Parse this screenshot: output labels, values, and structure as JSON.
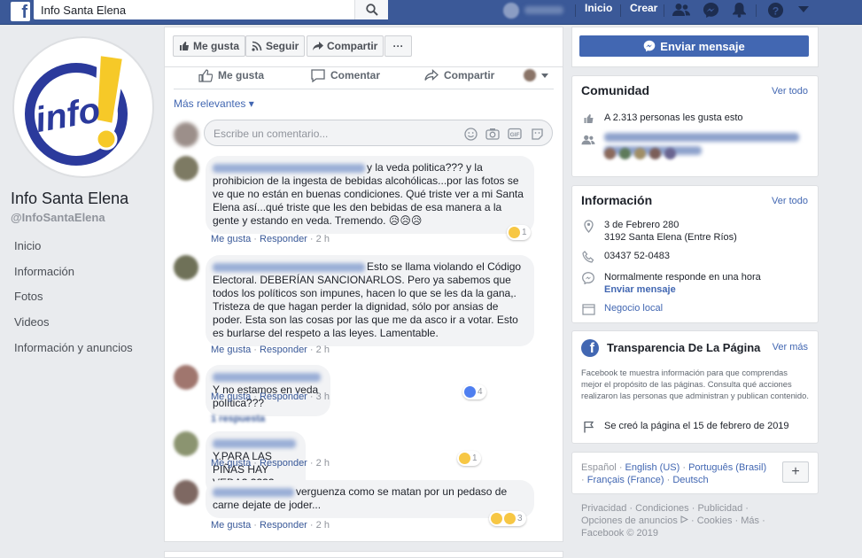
{
  "topbar": {
    "search_value": "Info Santa Elena",
    "home": "Inicio",
    "create": "Crear",
    "icons": [
      "friends-icon",
      "messenger-icon",
      "notifications-icon",
      "help-icon",
      "account-menu-icon"
    ],
    "brand_color": "#3b5998"
  },
  "page": {
    "name": "Info Santa Elena",
    "handle": "@InfoSantaElena",
    "logo_text": "info!",
    "nav": [
      "Inicio",
      "Información",
      "Fotos",
      "Videos",
      "Información y anuncios"
    ]
  },
  "actions": {
    "like": "Me gusta",
    "follow": "Seguir",
    "share": "Compartir",
    "more": "···",
    "send_message": "Enviar mensaje"
  },
  "post": {
    "like": "Me gusta",
    "comment": "Comentar",
    "share": "Compartir",
    "relevance": "Más relevantes ▾",
    "composer_placeholder": "Escribe un comentario...",
    "comments": [
      {
        "text": "y la veda politica??? y la prohibicion de la ingesta de bebidas alcohólicas...por las fotos se ve que no están en buenas condiciones. Qué triste ver a mi Santa Elena así...qué triste que les den bebidas de esa manera a la gente y estando en veda. Tremendo. 😥😥😥",
        "like": "Me gusta",
        "reply": "Responder",
        "time": "2 h",
        "reactions": "1"
      },
      {
        "text": "Esto se llama violando el Código Electoral. DEBERÍAN SANCIONARLOS. Pero ya sabemos que todos los políticos son impunes, hacen lo que se les da la gana,. Tristeza de que hagan perder la dignidad, sólo por ansias de poder. Esta son las cosas por las que me da asco ir a votar. Esto es burlarse del respeto a las leyes. Lamentable.",
        "like": "Me gusta",
        "reply": "Responder",
        "time": "2 h",
        "reactions": ""
      },
      {
        "text": "Y no estamos en veda política???",
        "like": "Me gusta",
        "reply": "Responder",
        "time": "3 h",
        "reactions": "4"
      },
      {
        "text": "Y.PARA LAS PIÑAS HAY VEDA? ????",
        "like": "Me gusta",
        "reply": "Responder",
        "time": "2 h",
        "reactions": "1"
      },
      {
        "text": "verguenza como se matan por un pedaso de carne dejate de joder...",
        "like": "Me gusta",
        "reply": "Responder",
        "time": "2 h",
        "reactions": "3"
      }
    ],
    "replies_label": "1 respuesta"
  },
  "community": {
    "title": "Comunidad",
    "see_all": "Ver todo",
    "likes_text": "A 2.313 personas les gusta esto"
  },
  "info": {
    "title": "Información",
    "see_all": "Ver todo",
    "address1": "3 de Febrero 280",
    "address2": "3192 Santa Elena (Entre Ríos)",
    "phone": "03437 52-0483",
    "response": "Normalmente responde en una hora",
    "send_message": "Enviar mensaje",
    "category": "Negocio local"
  },
  "transparency": {
    "title": "Transparencia De La Página",
    "see_more": "Ver más",
    "text": "Facebook te muestra información para que comprendas mejor el propósito de las páginas. Consulta qué acciones realizaron las personas que administran y publican contenido.",
    "created": "Se creó la página el 15 de febrero de 2019"
  },
  "languages": {
    "current": "Español",
    "options": [
      "English (US)",
      "Português (Brasil)",
      "Français (France)",
      "Deutsch"
    ],
    "plus": "+"
  },
  "footer": {
    "links": [
      "Privacidad",
      "Condiciones",
      "Publicidad",
      "Opciones de anuncios",
      "Cookies",
      "Más"
    ],
    "copyright": "Facebook © 2019"
  }
}
